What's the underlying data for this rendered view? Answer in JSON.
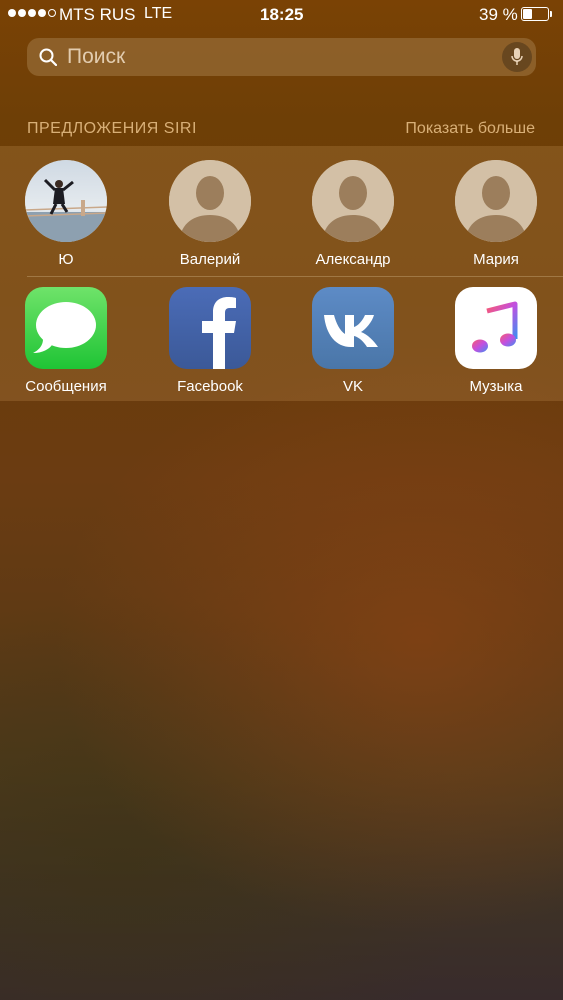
{
  "status_bar": {
    "carrier": "MTS RUS",
    "network": "LTE",
    "time": "18:25",
    "battery_percent": "39 %",
    "battery_level": 0.39,
    "signal_bars": 4,
    "signal_max": 5
  },
  "search": {
    "placeholder": "Поиск",
    "icon": "search-icon",
    "mic_icon": "microphone-icon"
  },
  "siri_suggestions": {
    "title": "ПРЕДЛОЖЕНИЯ SIRI",
    "show_more": "Показать больше",
    "contacts": [
      {
        "name": "Ю",
        "has_photo": true
      },
      {
        "name": "Валерий",
        "has_photo": false
      },
      {
        "name": "Александр",
        "has_photo": false
      },
      {
        "name": "Мария",
        "has_photo": false
      }
    ],
    "apps": [
      {
        "name": "Сообщения",
        "icon": "messages-icon",
        "color": "#34c759"
      },
      {
        "name": "Facebook",
        "icon": "facebook-icon",
        "color": "#3b5998"
      },
      {
        "name": "VK",
        "icon": "vk-icon",
        "color": "#4a76a8"
      },
      {
        "name": "Музыка",
        "icon": "music-icon",
        "color": "#fa2d55"
      }
    ]
  }
}
